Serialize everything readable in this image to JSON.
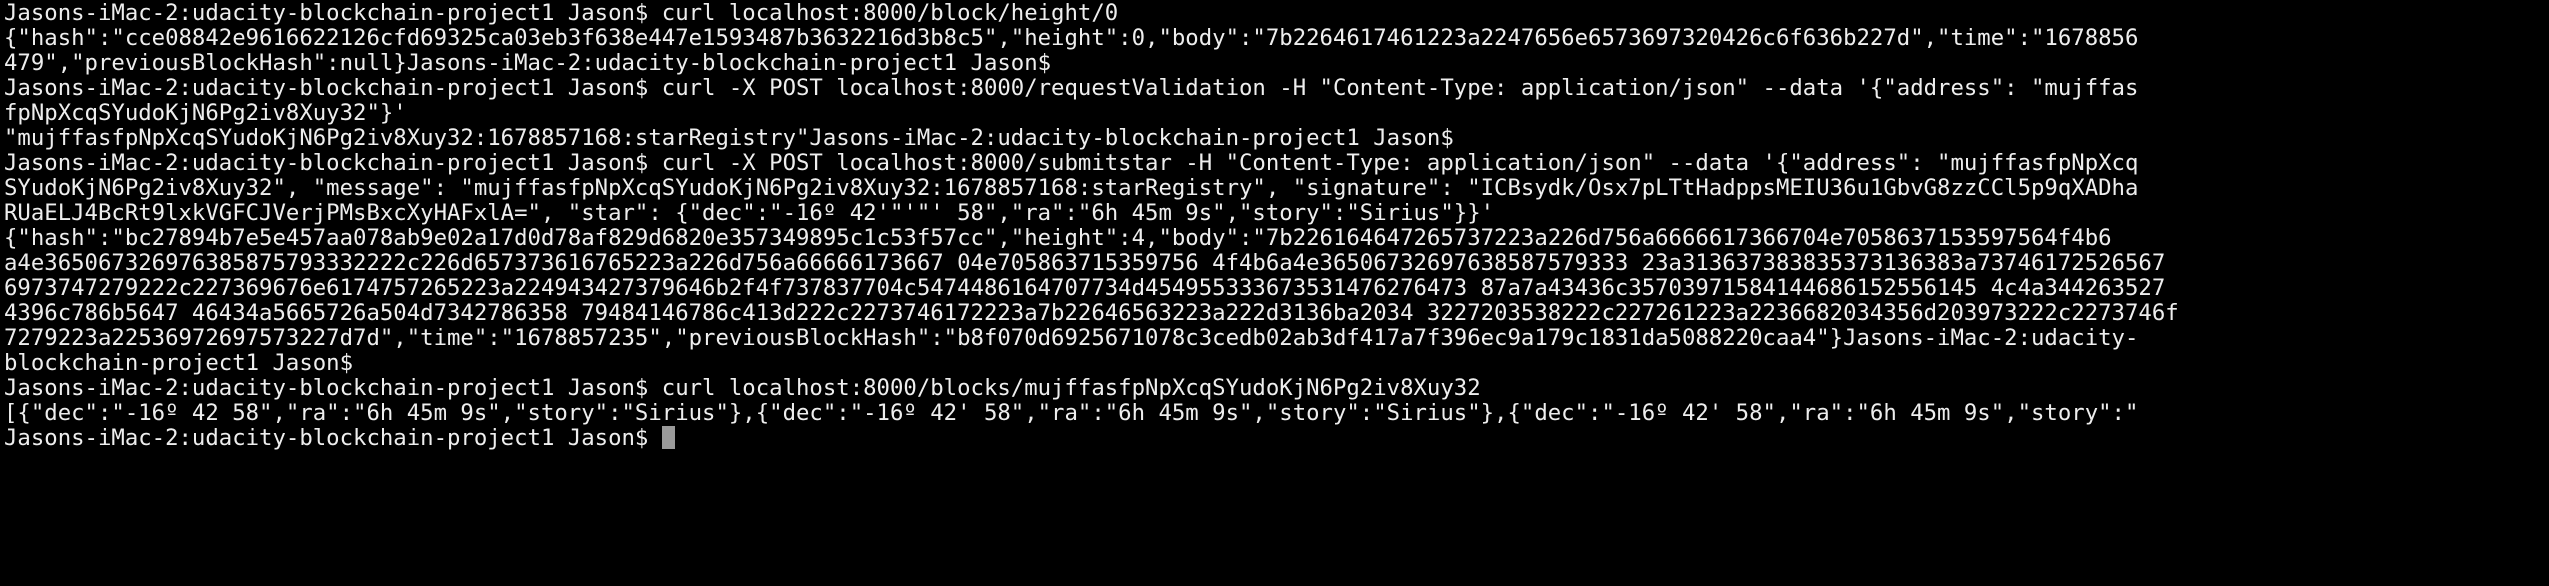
{
  "terminal": {
    "lines": [
      "Jasons-iMac-2:udacity-blockchain-project1 Jason$ curl localhost:8000/block/height/0",
      "{\"hash\":\"cce08842e9616622126cfd69325ca03eb3f638e447e1593487b3632216d3b8c5\",\"height\":0,\"body\":\"7b2264617461223a2247656e6573697320426c6f636b227d\",\"time\":\"1678856",
      "479\",\"previousBlockHash\":null}Jasons-iMac-2:udacity-blockchain-project1 Jason$",
      "Jasons-iMac-2:udacity-blockchain-project1 Jason$ curl -X POST localhost:8000/requestValidation -H \"Content-Type: application/json\" --data '{\"address\": \"mujffas",
      "fpNpXcqSYudoKjN6Pg2iv8Xuy32\"}'",
      "\"mujffasfpNpXcqSYudoKjN6Pg2iv8Xuy32:1678857168:starRegistry\"Jasons-iMac-2:udacity-blockchain-project1 Jason$",
      "Jasons-iMac-2:udacity-blockchain-project1 Jason$ curl -X POST localhost:8000/submitstar -H \"Content-Type: application/json\" --data '{\"address\": \"mujffasfpNpXcq",
      "SYudoKjN6Pg2iv8Xuy32\", \"message\": \"mujffasfpNpXcqSYudoKjN6Pg2iv8Xuy32:1678857168:starRegistry\", \"signature\": \"ICBsydk/Osx7pLTtHadppsMEIU36u1GbvG8zzCCl5p9qXADha",
      "RUaELJ4BcRt9lxkVGFCJVerjPMsBxcXyHAFxlA=\", \"star\": {\"dec\":\"-16º 42'\"'\"' 58\",\"ra\":\"6h 45m 9s\",\"story\":\"Sirius\"}}'",
      "{\"hash\":\"bc27894b7e5e457aa078ab9e02a17d0d78af829d6820e357349895c1c53f57cc\",\"height\":4,\"body\":\"7b226164647265737223a226d756a6666617366704e7058637153597564f4b6",
      "a4e365067326976385875793332222c226d657373616765223a226d756a66666173667 04e705863715359756 4f4b6a4e36506732697638587579333 23a313637383835373136383a73746172526567",
      "6973747279222c227369676e6174757265223a224943427379646b2f4f737837704c5474486164707734d454955333673531476276473 87a7a43436c35703971584144686152556145 4c4a344263527",
      "4396c786b5647 46434a5665726a504d7342786358 79484146786c413d222c2273746172223a7b22646563223a222d3136ba2034 3227203538222c227261223a2236682034356d203973222c2273746f",
      "7279223a22536972697573227d7d\",\"time\":\"1678857235\",\"previousBlockHash\":\"b8f070d6925671078c3cedb02ab3df417a7f396ec9a179c1831da5088220caa4\"}Jasons-iMac-2:udacity-",
      "blockchain-project1 Jason$",
      "Jasons-iMac-2:udacity-blockchain-project1 Jason$ curl localhost:8000/blocks/mujffasfpNpXcqSYudoKjN6Pg2iv8Xuy32",
      "[{\"dec\":\"-16º 42 58\",\"ra\":\"6h 45m 9s\",\"story\":\"Sirius\"},{\"dec\":\"-16º 42' 58\",\"ra\":\"6h 45m 9s\",\"story\":\"Sirius\"},{\"dec\":\"-16º 42' 58\",\"ra\":\"6h 45m 9s\",\"story\":\""
    ],
    "prompt": "Jasons-iMac-2:udacity-blockchain-project1 Jason$ ",
    "colors": {
      "background": "#000000",
      "foreground": "#eeeeee",
      "cursor": "#9a9a9a"
    }
  }
}
